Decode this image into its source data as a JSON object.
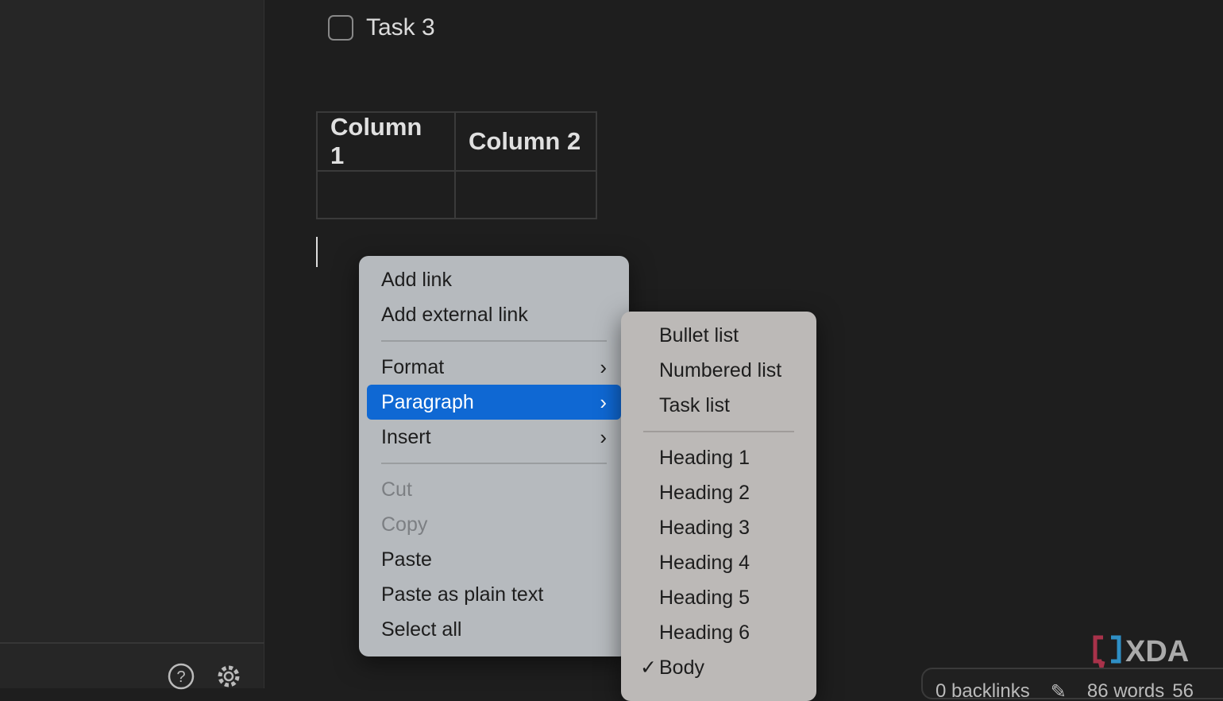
{
  "editor": {
    "task": "Task 3",
    "table": {
      "headers": [
        "Column 1",
        "Column 2"
      ],
      "rows": [
        [
          "",
          ""
        ]
      ]
    }
  },
  "context_menu": {
    "items": [
      {
        "label": "Add link"
      },
      {
        "label": "Add external link"
      },
      {
        "sep": true
      },
      {
        "label": "Format",
        "submenu": true
      },
      {
        "label": "Paragraph",
        "submenu": true,
        "highlighted": true
      },
      {
        "label": "Insert",
        "submenu": true
      },
      {
        "sep": true
      },
      {
        "label": "Cut",
        "disabled": true
      },
      {
        "label": "Copy",
        "disabled": true
      },
      {
        "label": "Paste"
      },
      {
        "label": "Paste as plain text"
      },
      {
        "label": "Select all"
      }
    ]
  },
  "paragraph_submenu": {
    "items": [
      {
        "label": "Bullet list"
      },
      {
        "label": "Numbered list"
      },
      {
        "label": "Task list"
      },
      {
        "sep": true
      },
      {
        "label": "Heading 1"
      },
      {
        "label": "Heading 2"
      },
      {
        "label": "Heading 3"
      },
      {
        "label": "Heading 4"
      },
      {
        "label": "Heading 5"
      },
      {
        "label": "Heading 6"
      },
      {
        "label": "Body",
        "checked": true
      }
    ]
  },
  "status_bar": {
    "backlinks": "0 backlinks",
    "words": "86 words",
    "chars": "56"
  },
  "watermark": "XDA",
  "colors": {
    "highlight": "#0f68d3",
    "background": "#1e1e1e",
    "sidebar": "#262626"
  }
}
